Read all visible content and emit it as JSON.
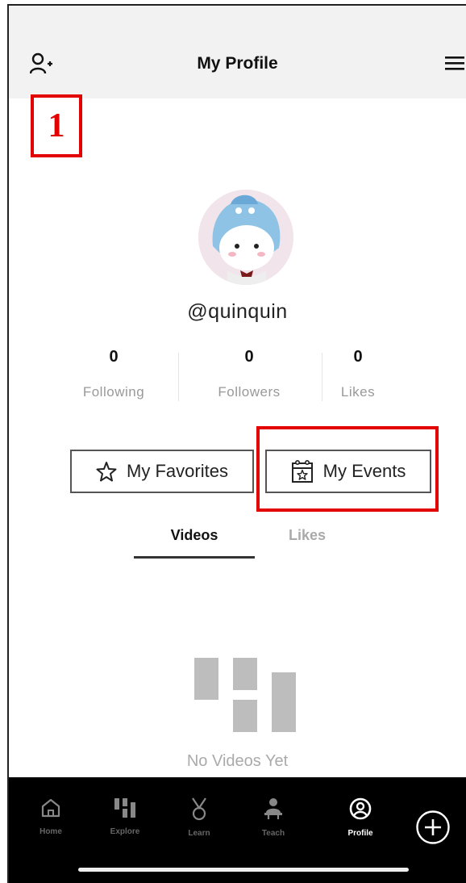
{
  "header": {
    "title": "My Profile",
    "left_icon": "add-user-icon",
    "right_icon": "menu-icon"
  },
  "annotation": {
    "step_number": "1",
    "highlight_color": "#e30000"
  },
  "profile": {
    "username": "@quinquin",
    "stats": [
      {
        "value": "0",
        "label": "Following"
      },
      {
        "value": "0",
        "label": "Followers"
      },
      {
        "value": "0",
        "label": "Likes"
      }
    ]
  },
  "actions": {
    "favorites": {
      "label": "My Favorites",
      "icon": "star-icon"
    },
    "events": {
      "label": "My Events",
      "icon": "calendar-star-icon"
    }
  },
  "tabs": [
    {
      "label": "Videos",
      "active": true
    },
    {
      "label": "Likes",
      "active": false
    }
  ],
  "empty_state": {
    "text": "No Videos Yet"
  },
  "bottom_nav": {
    "items": [
      {
        "label": "Home",
        "icon": "home-icon"
      },
      {
        "label": "Explore",
        "icon": "explore-icon"
      },
      {
        "label": "Learn",
        "icon": "medal-icon"
      },
      {
        "label": "Teach",
        "icon": "teach-icon"
      },
      {
        "label": "Profile",
        "icon": "profile-icon",
        "active": true
      }
    ],
    "add_icon": "plus-circle-icon"
  }
}
